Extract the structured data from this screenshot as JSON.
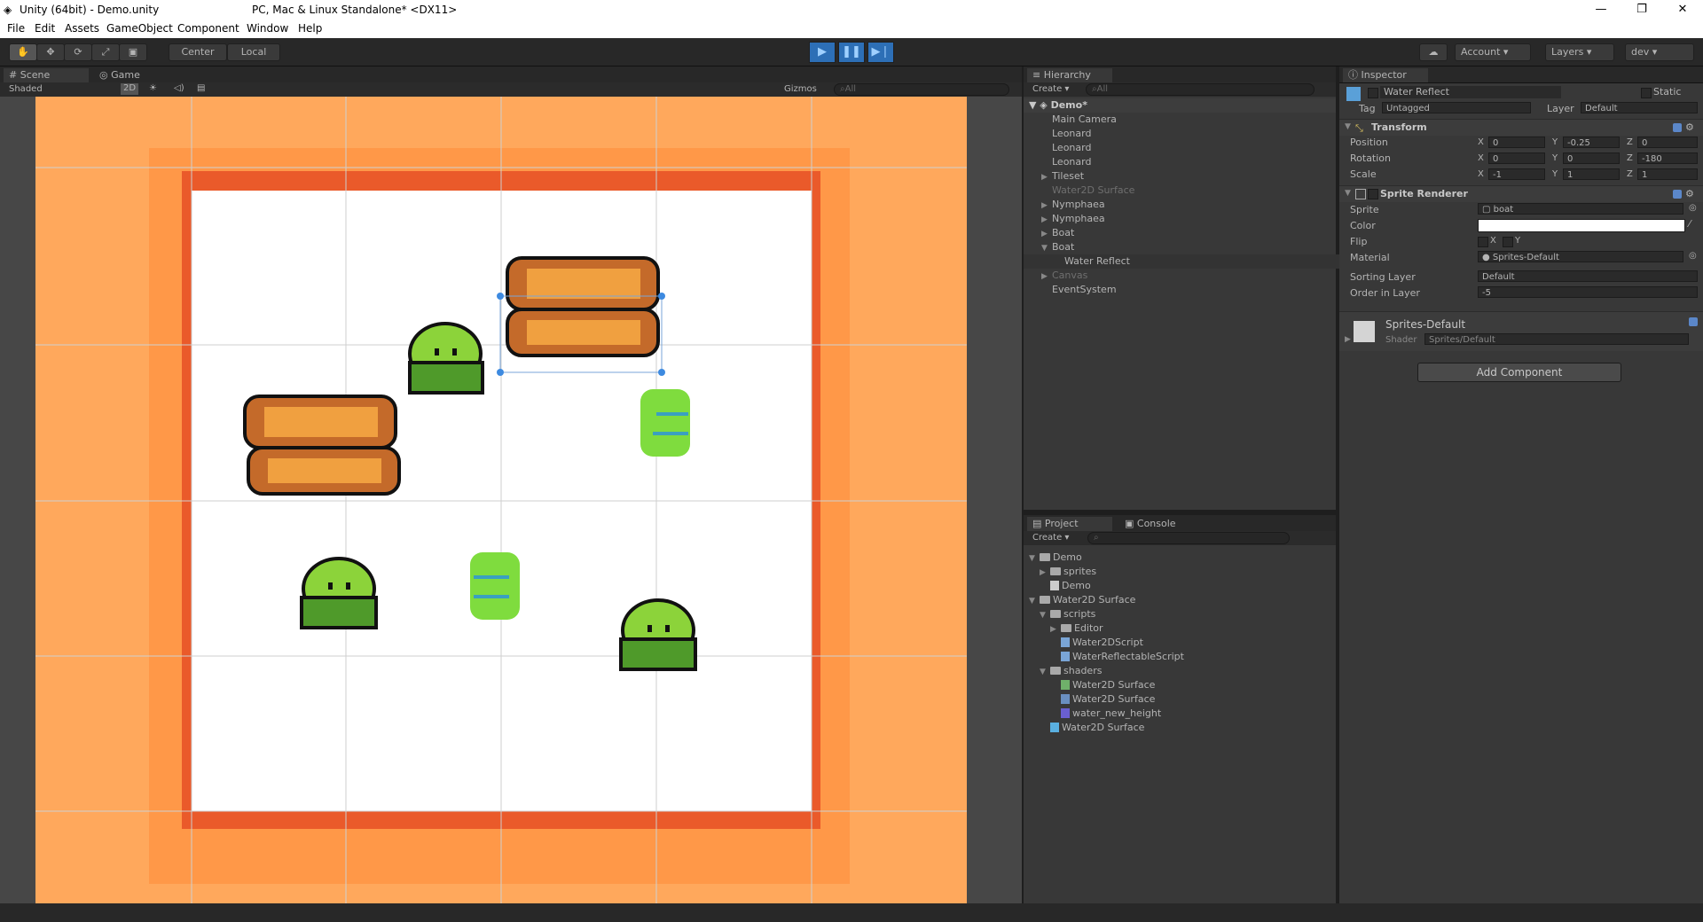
{
  "titlebar": {
    "app_title": "Unity (64bit) - Demo.unity",
    "platform": "PC, Mac & Linux Standalone* <DX11>",
    "minimize": "—",
    "maximize": "❐",
    "close": "✕"
  },
  "menu": [
    "File",
    "Edit",
    "Assets",
    "GameObject",
    "Component",
    "Window",
    "Help"
  ],
  "toolbar": {
    "pivot_center": "Center",
    "pivot_local": "Local",
    "account": "Account",
    "layers": "Layers",
    "layout": "dev"
  },
  "scene_panel": {
    "tab_scene": "Scene",
    "tab_game": "Game",
    "shading": "Shaded",
    "mode_2d": "2D",
    "gizmos": "Gizmos",
    "search_placeholder": "All"
  },
  "hierarchy": {
    "tab": "Hierarchy",
    "create": "Create",
    "search_placeholder": "All",
    "scene_name": "Demo*",
    "items": [
      {
        "label": "Main Camera",
        "indent": 1,
        "arrow": "",
        "dim": false
      },
      {
        "label": "Leonard",
        "indent": 1,
        "arrow": "",
        "dim": false
      },
      {
        "label": "Leonard",
        "indent": 1,
        "arrow": "",
        "dim": false
      },
      {
        "label": "Leonard",
        "indent": 1,
        "arrow": "",
        "dim": false
      },
      {
        "label": "Tileset",
        "indent": 1,
        "arrow": "▶",
        "dim": false
      },
      {
        "label": "Water2D Surface",
        "indent": 1,
        "arrow": "",
        "dim": true
      },
      {
        "label": "Nymphaea",
        "indent": 1,
        "arrow": "▶",
        "dim": false
      },
      {
        "label": "Nymphaea",
        "indent": 1,
        "arrow": "▶",
        "dim": false
      },
      {
        "label": "Boat",
        "indent": 1,
        "arrow": "▶",
        "dim": false
      },
      {
        "label": "Boat",
        "indent": 1,
        "arrow": "▼",
        "dim": false
      },
      {
        "label": "Water Reflect",
        "indent": 2,
        "arrow": "",
        "dim": false,
        "selected": true
      },
      {
        "label": "Canvas",
        "indent": 1,
        "arrow": "▶",
        "dim": true
      },
      {
        "label": "EventSystem",
        "indent": 1,
        "arrow": "",
        "dim": false
      }
    ]
  },
  "project": {
    "tab_project": "Project",
    "tab_console": "Console",
    "create": "Create",
    "items": [
      {
        "label": "Demo",
        "indent": 0,
        "arrow": "▼",
        "kind": "folder"
      },
      {
        "label": "sprites",
        "indent": 1,
        "arrow": "▶",
        "kind": "folder"
      },
      {
        "label": "Demo",
        "indent": 1,
        "arrow": "",
        "kind": "unity"
      },
      {
        "label": "Water2D Surface",
        "indent": 0,
        "arrow": "▼",
        "kind": "folder"
      },
      {
        "label": "scripts",
        "indent": 1,
        "arrow": "▼",
        "kind": "folder"
      },
      {
        "label": "Editor",
        "indent": 2,
        "arrow": "▶",
        "kind": "folder"
      },
      {
        "label": "Water2DScript",
        "indent": 2,
        "arrow": "",
        "kind": "script"
      },
      {
        "label": "WaterReflectableScript",
        "indent": 2,
        "arrow": "",
        "kind": "script"
      },
      {
        "label": "shaders",
        "indent": 1,
        "arrow": "▼",
        "kind": "folder"
      },
      {
        "label": "Water2D Surface",
        "indent": 2,
        "arrow": "",
        "kind": "shader"
      },
      {
        "label": "Water2D Surface",
        "indent": 2,
        "arrow": "",
        "kind": "material"
      },
      {
        "label": "water_new_height",
        "indent": 2,
        "arrow": "",
        "kind": "texture"
      },
      {
        "label": "Water2D Surface",
        "indent": 1,
        "arrow": "",
        "kind": "prefab"
      }
    ]
  },
  "inspector": {
    "tab": "Inspector",
    "object_name": "Water Reflect",
    "static_label": "Static",
    "tag_label": "Tag",
    "tag_value": "Untagged",
    "layer_label": "Layer",
    "layer_value": "Default",
    "transform": {
      "title": "Transform",
      "position_label": "Position",
      "rotation_label": "Rotation",
      "scale_label": "Scale",
      "position": {
        "x": "0",
        "y": "-0.25",
        "z": "0"
      },
      "rotation": {
        "x": "0",
        "y": "0",
        "z": "-180"
      },
      "scale": {
        "x": "-1",
        "y": "1",
        "z": "1"
      }
    },
    "sprite_renderer": {
      "title": "Sprite Renderer",
      "sprite_label": "Sprite",
      "sprite_value": "boat",
      "color_label": "Color",
      "flip_label": "Flip",
      "flip_x": "X",
      "flip_y": "Y",
      "material_label": "Material",
      "material_value": "Sprites-Default",
      "sorting_layer_label": "Sorting Layer",
      "sorting_layer_value": "Default",
      "order_label": "Order in Layer",
      "order_value": "-5"
    },
    "material_block": {
      "name": "Sprites-Default",
      "shader_label": "Shader",
      "shader_value": "Sprites/Default"
    },
    "add_component": "Add Component"
  },
  "colors": {
    "editor_bg": "#383838",
    "scene_orange": "#ffa85c",
    "border_red": "#ea5a2a",
    "leaf_green": "#8cd33a",
    "boat_brown": "#c46a2a",
    "selection_blue": "#3d8ae0"
  }
}
